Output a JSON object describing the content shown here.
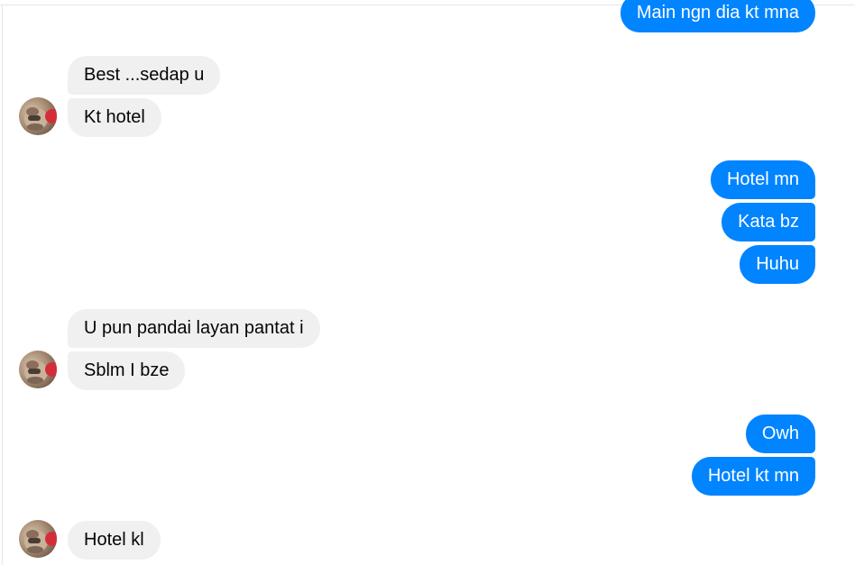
{
  "conversation": {
    "messages": [
      {
        "side": "out",
        "text": "Main ngn dia kt mna"
      },
      {
        "side": "in",
        "text": "Best ...sedap u"
      },
      {
        "side": "in",
        "text": "Kt hotel"
      },
      {
        "side": "out",
        "text": "Hotel mn"
      },
      {
        "side": "out",
        "text": "Kata bz"
      },
      {
        "side": "out",
        "text": "Huhu"
      },
      {
        "side": "in",
        "text": "U pun pandai layan pantat i"
      },
      {
        "side": "in",
        "text": "Sblm I bze"
      },
      {
        "side": "out",
        "text": "Owh"
      },
      {
        "side": "out",
        "text": "Hotel kt mn"
      },
      {
        "side": "in",
        "text": "Hotel kl"
      }
    ]
  },
  "colors": {
    "outgoing_bubble": "#0084ff",
    "incoming_bubble": "#f0f0f0",
    "outgoing_text": "#ffffff",
    "incoming_text": "#050505"
  },
  "icons": {
    "contact_avatar": "contact-avatar-icon"
  }
}
